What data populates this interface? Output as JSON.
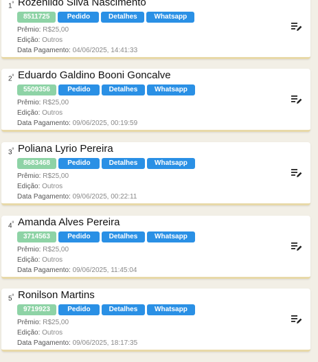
{
  "labels": {
    "pedido": "Pedido",
    "detalhes": "Detalhes",
    "whatsapp": "Whatsapp",
    "premio": "Prêmio:",
    "edicao": "Edição:",
    "data_pagamento": "Data Pagamento:"
  },
  "icons": {
    "edit": "edit-list-icon"
  },
  "colors": {
    "badge": "#8ed3a6",
    "button": "#2a90e5",
    "card_border": "#e8d9a8"
  },
  "entries": [
    {
      "rank": "1",
      "rank_suffix": "º",
      "name": "Rozenildo Silva Nascimento",
      "code": "8511725",
      "premio": "R$25,00",
      "edicao": "Outros",
      "data_pagamento": "04/06/2025, 14:41:33"
    },
    {
      "rank": "2",
      "rank_suffix": "º",
      "name": "Eduardo Galdino Booni Goncalve",
      "code": "5509356",
      "premio": "R$25,00",
      "edicao": "Outros",
      "data_pagamento": "09/06/2025, 00:19:59"
    },
    {
      "rank": "3",
      "rank_suffix": "º",
      "name": "Poliana Lyrio Pereira",
      "code": "8683468",
      "premio": "R$25,00",
      "edicao": "Outros",
      "data_pagamento": "09/06/2025, 00:22:11"
    },
    {
      "rank": "4",
      "rank_suffix": "º",
      "name": "Amanda Alves Pereira",
      "code": "3714563",
      "premio": "R$25,00",
      "edicao": "Outros",
      "data_pagamento": "09/06/2025, 11:45:04"
    },
    {
      "rank": "5",
      "rank_suffix": "º",
      "name": "Ronilson Martins",
      "code": "9719923",
      "premio": "R$25,00",
      "edicao": "Outros",
      "data_pagamento": "09/06/2025, 18:17:35"
    }
  ]
}
